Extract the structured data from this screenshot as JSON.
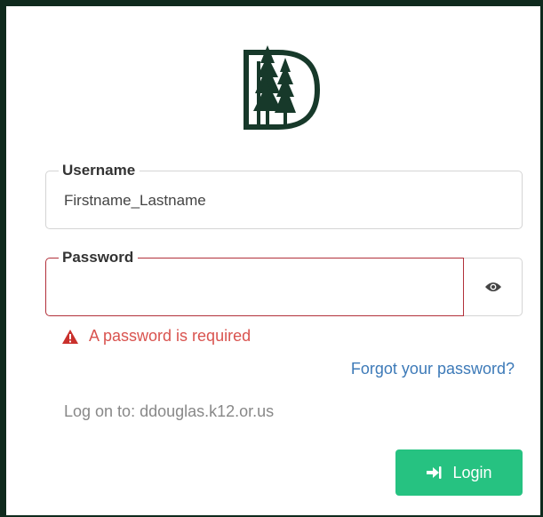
{
  "brand": {
    "logo_icon": "pine-trees-letter-d-logo",
    "color": "#17392a"
  },
  "form": {
    "username": {
      "label": "Username",
      "value": "Firstname_Lastname"
    },
    "password": {
      "label": "Password",
      "value": "",
      "toggle_icon": "eye-icon"
    },
    "error": {
      "icon": "warning-triangle-icon",
      "text": "A password is required",
      "color": "#d9534f"
    },
    "forgot_link": "Forgot your password?",
    "logon_text": "Log on to: ddouglas.k12.or.us",
    "login_button": {
      "label": "Login",
      "icon": "sign-in-icon",
      "color": "#26c281"
    }
  }
}
